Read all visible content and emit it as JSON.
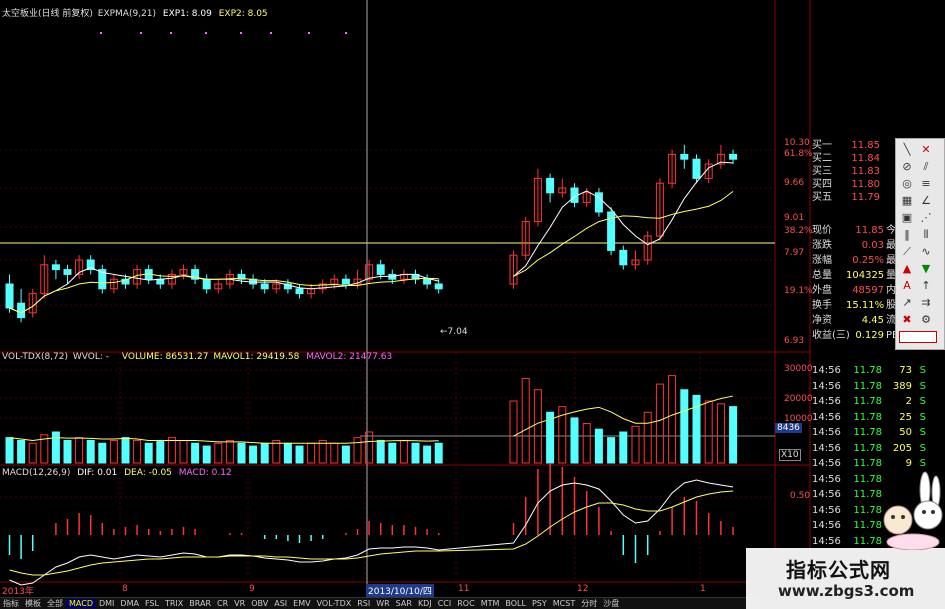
{
  "header": {
    "title": "太空板业(日线 前复权)",
    "expma": "EXPMA(9,21)",
    "exp1": "EXP1: 8.09",
    "exp2": "EXP2: 8.05"
  },
  "price_axis": {
    "labels": [
      "10.30",
      "61.8%",
      "9.66",
      "9.01",
      "38.2%",
      "7.97",
      "19.1%",
      "6.93"
    ],
    "note": "←7.04"
  },
  "volume_panel": {
    "label": "VOL-TDX(8,72)",
    "wvol": "WVOL: -",
    "volume": "VOLUME: 86531.27",
    "mavol1": "MAVOL1: 29419.58",
    "mavol2": "MAVOL2: 21477.63",
    "axis": [
      "30000",
      "20000",
      "10000",
      "X10"
    ],
    "marker": "8436"
  },
  "macd_panel": {
    "label": "MACD(12,26,9)",
    "dif": "DIF: 0.01",
    "dea": "DEA: -0.05",
    "macd": "MACD: 0.12",
    "axis": "0.50"
  },
  "date_axis": {
    "labels": [
      "2013年",
      "8",
      "9",
      "2013/10/10/四",
      "11",
      "12",
      "1"
    ]
  },
  "order_book": [
    {
      "label": "买一",
      "value": "11.85"
    },
    {
      "label": "买二",
      "value": "11.84"
    },
    {
      "label": "买三",
      "value": "11.83"
    },
    {
      "label": "买四",
      "value": "11.80"
    },
    {
      "label": "买五",
      "value": "11.79"
    }
  ],
  "quote": [
    {
      "label": "现价",
      "value": "11.85",
      "extra": "今",
      "color": "#ff4d4d"
    },
    {
      "label": "涨跌",
      "value": "0.03",
      "extra": "最",
      "color": "#ff4d4d"
    },
    {
      "label": "涨幅",
      "value": "0.25%",
      "extra": "最",
      "color": "#ff4d4d"
    },
    {
      "label": "总量",
      "value": "104325",
      "extra": "量",
      "color": "#ffff66"
    },
    {
      "label": "外盘",
      "value": "48597",
      "extra": "内",
      "color": "#ff4d4d"
    },
    {
      "label": "换手",
      "value": "15.11%",
      "extra": "股",
      "color": "#ffff66"
    },
    {
      "label": "净资",
      "value": "4.45",
      "extra": "流",
      "color": "#ffff66"
    },
    {
      "label": "收益(三)",
      "value": "0.129",
      "extra": "PE",
      "color": "#ffff66"
    }
  ],
  "ticks": [
    {
      "time": "14:56",
      "price": "11.78",
      "vol": "73",
      "side": "S"
    },
    {
      "time": "14:56",
      "price": "11.78",
      "vol": "389",
      "side": "S"
    },
    {
      "time": "14:56",
      "price": "11.78",
      "vol": "2",
      "side": "S"
    },
    {
      "time": "14:56",
      "price": "11.78",
      "vol": "25",
      "side": "S"
    },
    {
      "time": "14:56",
      "price": "11.78",
      "vol": "50",
      "side": "S"
    },
    {
      "time": "14:56",
      "price": "11.78",
      "vol": "205",
      "side": "S"
    },
    {
      "time": "14:56",
      "price": "11.78",
      "vol": "9",
      "side": "S"
    },
    {
      "time": "14:56",
      "price": "11.78",
      "vol": "",
      "side": ""
    },
    {
      "time": "14:56",
      "price": "11.78",
      "vol": "",
      "side": ""
    },
    {
      "time": "14:56",
      "price": "11.78",
      "vol": "",
      "side": ""
    },
    {
      "time": "14:56",
      "price": "11.78",
      "vol": "",
      "side": ""
    },
    {
      "time": "14:56",
      "price": "11.78",
      "vol": "",
      "side": ""
    }
  ],
  "tabs": [
    "指标",
    "模板",
    "全部",
    "MACD",
    "DMI",
    "DMA",
    "FSL",
    "TRIX",
    "BRAR",
    "CR",
    "VR",
    "OBV",
    "ASI",
    "EMV",
    "VOL-TDX",
    "RSI",
    "WR",
    "SAR",
    "KDJ",
    "CCI",
    "ROC",
    "MTM",
    "BOLL",
    "PSY",
    "MCST",
    "分时",
    "沙盘"
  ],
  "watermark": {
    "line1": "指标公式网",
    "line2": "www.zbgs3.com"
  },
  "colors": {
    "up": "#ff3333",
    "down": "#54ffff",
    "ma1": "#ffffff",
    "ma2": "#ffff66",
    "grid": "#8b0000",
    "level": "#c9c96a",
    "purple": "#ff66ff"
  },
  "chart_data": {
    "type": "candlestick",
    "candles": [
      [
        7.6,
        7.1,
        7.8,
        7.0
      ],
      [
        7.2,
        6.9,
        7.5,
        6.8
      ],
      [
        7.0,
        7.4,
        7.5,
        6.9
      ],
      [
        7.4,
        8.0,
        8.2,
        7.3
      ],
      [
        8.0,
        7.9,
        8.1,
        7.7
      ],
      [
        7.9,
        7.8,
        8.0,
        7.6
      ],
      [
        7.8,
        8.1,
        8.2,
        7.7
      ],
      [
        8.1,
        7.9,
        8.2,
        7.8
      ],
      [
        7.9,
        7.5,
        8.0,
        7.4
      ],
      [
        7.5,
        7.7,
        7.8,
        7.4
      ],
      [
        7.7,
        7.6,
        7.8,
        7.5
      ],
      [
        7.6,
        7.9,
        8.0,
        7.5
      ],
      [
        7.9,
        7.7,
        8.0,
        7.6
      ],
      [
        7.7,
        7.6,
        7.8,
        7.5
      ],
      [
        7.6,
        7.8,
        7.9,
        7.5
      ],
      [
        7.8,
        7.9,
        8.0,
        7.7
      ],
      [
        7.9,
        7.7,
        8.0,
        7.6
      ],
      [
        7.7,
        7.5,
        7.8,
        7.4
      ],
      [
        7.5,
        7.6,
        7.7,
        7.4
      ],
      [
        7.6,
        7.8,
        7.9,
        7.5
      ],
      [
        7.8,
        7.7,
        7.9,
        7.6
      ],
      [
        7.7,
        7.6,
        7.8,
        7.5
      ],
      [
        7.6,
        7.5,
        7.7,
        7.4
      ],
      [
        7.5,
        7.6,
        7.7,
        7.4
      ],
      [
        7.6,
        7.5,
        7.7,
        7.4
      ],
      [
        7.5,
        7.4,
        7.6,
        7.3
      ],
      [
        7.4,
        7.5,
        7.6,
        7.3
      ],
      [
        7.5,
        7.6,
        7.7,
        7.4
      ],
      [
        7.6,
        7.7,
        7.8,
        7.5
      ],
      [
        7.7,
        7.6,
        7.8,
        7.5
      ],
      [
        7.6,
        7.7,
        7.9,
        7.5
      ],
      [
        7.7,
        8.0,
        8.1,
        7.6
      ],
      [
        8.0,
        7.8,
        8.1,
        7.7
      ],
      [
        7.8,
        7.7,
        7.9,
        7.6
      ],
      [
        7.7,
        7.8,
        7.9,
        7.6
      ],
      [
        7.8,
        7.7,
        7.9,
        7.6
      ],
      [
        7.7,
        7.6,
        7.8,
        7.5
      ],
      [
        7.6,
        7.5,
        7.7,
        7.4
      ],
      [
        7.6,
        8.2,
        8.3,
        7.5
      ],
      [
        8.2,
        8.9,
        9.0,
        8.1
      ],
      [
        8.9,
        9.8,
        10.0,
        8.8
      ],
      [
        9.8,
        9.5,
        9.9,
        9.3
      ],
      [
        9.5,
        9.6,
        9.8,
        9.4
      ],
      [
        9.6,
        9.3,
        9.7,
        9.2
      ],
      [
        9.3,
        9.5,
        9.6,
        9.2
      ],
      [
        9.5,
        9.1,
        9.6,
        9.0
      ],
      [
        9.1,
        8.3,
        9.2,
        8.2
      ],
      [
        8.3,
        8.0,
        8.4,
        7.9
      ],
      [
        8.0,
        8.1,
        8.3,
        7.9
      ],
      [
        8.1,
        8.6,
        8.7,
        8.0
      ],
      [
        8.6,
        9.7,
        9.8,
        8.5
      ],
      [
        9.7,
        10.3,
        10.4,
        9.6
      ],
      [
        10.3,
        10.2,
        10.5,
        10.0
      ],
      [
        10.2,
        9.8,
        10.3,
        9.7
      ],
      [
        9.8,
        10.1,
        10.2,
        9.7
      ],
      [
        10.1,
        10.3,
        10.5,
        10.0
      ],
      [
        10.3,
        10.2,
        10.4,
        10.1
      ]
    ],
    "volume": [
      9,
      8,
      7,
      10,
      11,
      8,
      9,
      8,
      7,
      8,
      9,
      8,
      7,
      8,
      9,
      8,
      7,
      6,
      7,
      8,
      7,
      6,
      7,
      8,
      7,
      6,
      7,
      8,
      7,
      6,
      9,
      11,
      8,
      7,
      8,
      7,
      6,
      7,
      22,
      30,
      26,
      18,
      20,
      16,
      14,
      12,
      9,
      11,
      13,
      18,
      28,
      31,
      26,
      24,
      22,
      21,
      20
    ],
    "dif": [
      -0.45,
      -0.5,
      -0.48,
      -0.4,
      -0.32,
      -0.28,
      -0.22,
      -0.2,
      -0.22,
      -0.24,
      -0.22,
      -0.2,
      -0.21,
      -0.22,
      -0.2,
      -0.18,
      -0.19,
      -0.22,
      -0.22,
      -0.2,
      -0.2,
      -0.21,
      -0.23,
      -0.24,
      -0.25,
      -0.27,
      -0.27,
      -0.26,
      -0.24,
      -0.23,
      -0.2,
      -0.14,
      -0.13,
      -0.13,
      -0.12,
      -0.12,
      -0.13,
      -0.15,
      -0.08,
      0.1,
      0.32,
      0.44,
      0.5,
      0.52,
      0.5,
      0.46,
      0.34,
      0.2,
      0.12,
      0.14,
      0.26,
      0.42,
      0.52,
      0.55,
      0.52,
      0.5,
      0.48
    ],
    "dea": [
      -0.35,
      -0.38,
      -0.4,
      -0.4,
      -0.38,
      -0.36,
      -0.33,
      -0.3,
      -0.28,
      -0.27,
      -0.26,
      -0.25,
      -0.24,
      -0.24,
      -0.23,
      -0.22,
      -0.22,
      -0.22,
      -0.22,
      -0.21,
      -0.21,
      -0.21,
      -0.21,
      -0.22,
      -0.22,
      -0.23,
      -0.24,
      -0.24,
      -0.24,
      -0.24,
      -0.23,
      -0.21,
      -0.19,
      -0.18,
      -0.17,
      -0.16,
      -0.16,
      -0.16,
      -0.14,
      -0.09,
      -0.01,
      0.08,
      0.16,
      0.23,
      0.28,
      0.32,
      0.32,
      0.3,
      0.26,
      0.24,
      0.24,
      0.28,
      0.33,
      0.38,
      0.41,
      0.43,
      0.44
    ]
  }
}
